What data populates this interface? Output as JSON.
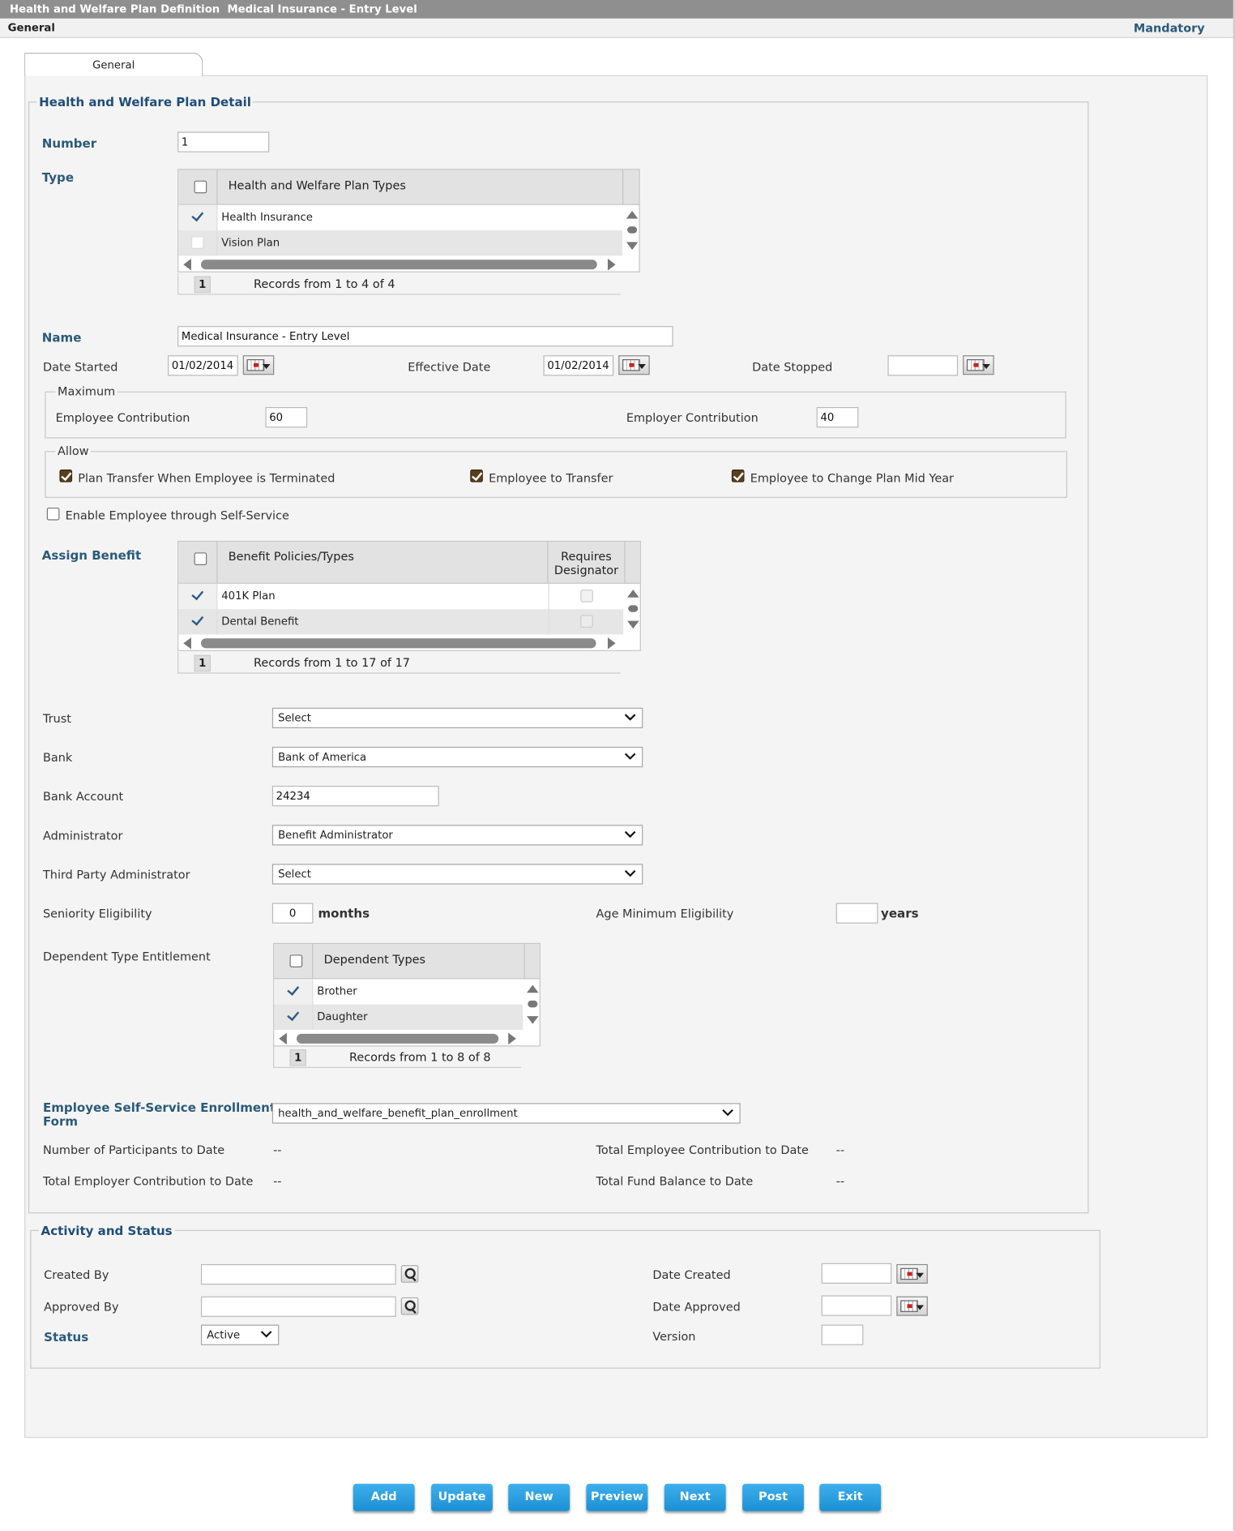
{
  "window": {
    "title": "Health and Welfare Plan Definition  Medical Insurance - Entry Level",
    "section_label": "General",
    "mandatory_label": "Mandatory"
  },
  "tabs": [
    {
      "label": "General",
      "active": true
    }
  ],
  "plan_detail": {
    "legend": "Health and Welfare Plan Detail",
    "number": {
      "label": "Number",
      "value": "1"
    },
    "type": {
      "label": "Type",
      "grid_header": "Health and Welfare Plan Types",
      "rows": [
        {
          "label": "Health Insurance",
          "checked": true
        },
        {
          "label": "Vision Plan",
          "checked": false
        }
      ],
      "page": "1",
      "records": "Records from 1 to 4 of 4"
    },
    "name": {
      "label": "Name",
      "value": "Medical Insurance - Entry Level"
    },
    "date_started": {
      "label": "Date Started",
      "value": "01/02/2014"
    },
    "effective_date": {
      "label": "Effective Date",
      "value": "01/02/2014"
    },
    "date_stopped": {
      "label": "Date Stopped",
      "value": ""
    },
    "maximum": {
      "legend": "Maximum",
      "employee_contribution": {
        "label": "Employee Contribution",
        "value": "60"
      },
      "employer_contribution": {
        "label": "Employer Contribution",
        "value": "40"
      }
    },
    "allow": {
      "legend": "Allow",
      "plan_transfer": {
        "label": "Plan Transfer When Employee is Terminated",
        "checked": true
      },
      "employee_transfer": {
        "label": "Employee to Transfer",
        "checked": true
      },
      "change_mid_year": {
        "label": "Employee to Change Plan Mid Year",
        "checked": true
      }
    },
    "self_service": {
      "label": "Enable Employee through Self-Service",
      "checked": false
    },
    "assign_benefit": {
      "label": "Assign Benefit",
      "col_policy": "Benefit Policies/Types",
      "col_requires_1": "Requires",
      "col_requires_2": "Designator",
      "rows": [
        {
          "label": "401K Plan",
          "checked": true,
          "designator": false
        },
        {
          "label": "Dental Benefit",
          "checked": true,
          "designator": false
        }
      ],
      "page": "1",
      "records": "Records from 1 to 17 of 17"
    },
    "trust": {
      "label": "Trust",
      "value": "Select"
    },
    "bank": {
      "label": "Bank",
      "value": "Bank of America"
    },
    "bank_account": {
      "label": "Bank Account",
      "value": "24234"
    },
    "administrator": {
      "label": "Administrator",
      "value": "Benefit Administrator"
    },
    "third_party": {
      "label": "Third Party Administrator",
      "value": "Select"
    },
    "seniority": {
      "label": "Seniority Eligibility",
      "value": "0",
      "unit": "months"
    },
    "age_min": {
      "label": "Age Minimum Eligibility",
      "value": "",
      "unit": "years"
    },
    "dependent": {
      "label": "Dependent Type Entitlement",
      "grid_header": "Dependent Types",
      "rows": [
        {
          "label": "Brother",
          "checked": true
        },
        {
          "label": "Daughter",
          "checked": true
        }
      ],
      "page": "1",
      "records": "Records from 1 to 8 of 8"
    },
    "ess_form": {
      "label_1": "Employee Self-Service Enrollment",
      "label_2": "Form",
      "value": "health_and_welfare_benefit_plan_enrollment"
    },
    "participants": {
      "label": "Number of Participants to Date",
      "value": "--"
    },
    "total_employee": {
      "label": "Total Employee Contribution to Date",
      "value": "--"
    },
    "total_employer": {
      "label": "Total Employer Contribution to Date",
      "value": "--"
    },
    "fund_balance": {
      "label": "Total Fund Balance to Date",
      "value": "--"
    }
  },
  "activity": {
    "legend": "Activity and Status",
    "created_by": {
      "label": "Created By",
      "value": ""
    },
    "approved_by": {
      "label": "Approved By",
      "value": ""
    },
    "status": {
      "label": "Status",
      "value": "Active"
    },
    "date_created": {
      "label": "Date Created",
      "value": ""
    },
    "date_approved": {
      "label": "Date Approved",
      "value": ""
    },
    "version": {
      "label": "Version",
      "value": ""
    }
  },
  "buttons": {
    "add": "Add",
    "update": "Update",
    "new": "New",
    "preview": "Preview",
    "next": "Next",
    "post": "Post",
    "exit": "Exit"
  },
  "colors": {
    "accent": "#1f4e79",
    "button": "#2a9ee0",
    "title_bar": "#8f8f8f"
  }
}
